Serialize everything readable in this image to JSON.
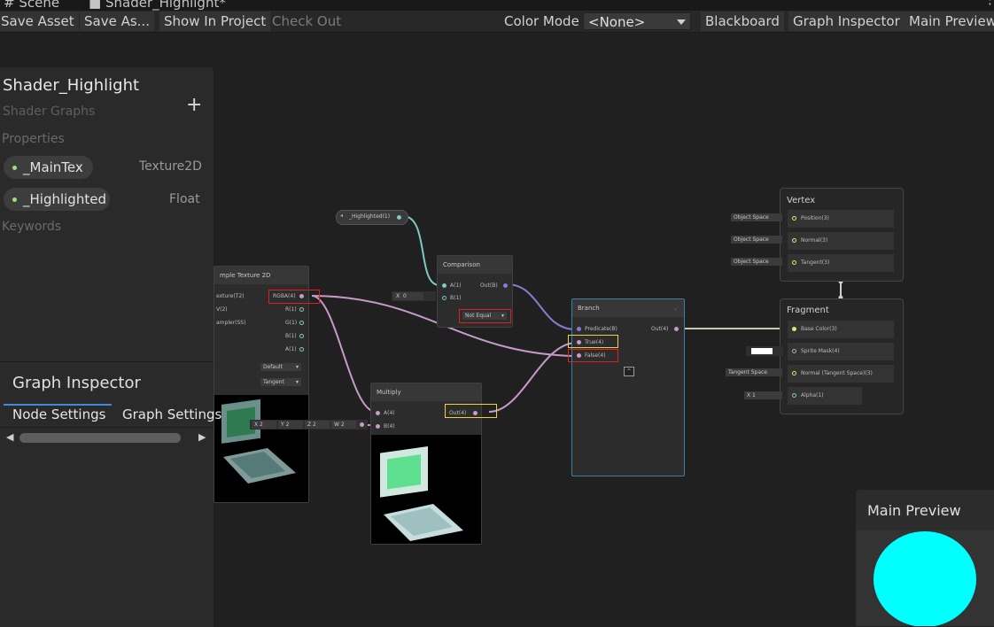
{
  "tabs": [
    {
      "label": "Scene",
      "icon": "hash-icon"
    },
    {
      "label": "Shader_Highlight*",
      "icon": "shader-icon"
    }
  ],
  "toolbar": {
    "save_asset": "Save Asset",
    "save_as": "Save As...",
    "show_in_project": "Show In Project",
    "check_out": "Check Out",
    "color_mode_label": "Color Mode",
    "color_mode_value": "<None>",
    "blackboard": "Blackboard",
    "graph_inspector": "Graph Inspector",
    "main_preview": "Main Preview"
  },
  "blackboard": {
    "title": "Shader_Highlight",
    "subtitle": "Shader Graphs",
    "add_icon": "plus-icon",
    "properties_header": "Properties",
    "properties": [
      {
        "name": "_MainTex",
        "type": "Texture2D"
      },
      {
        "name": "_Highlighted",
        "type": "Float"
      }
    ],
    "keywords_header": "Keywords"
  },
  "inspector": {
    "title": "Graph Inspector",
    "tabs": [
      "Node Settings",
      "Graph Settings"
    ]
  },
  "main_preview": {
    "title": "Main Preview",
    "preview_color": "#00ffff"
  },
  "graph": {
    "property_node": {
      "label": "_Highlighted(1)"
    },
    "sample_texture": {
      "title": "mple Texture 2D",
      "inputs": [
        "exture(T2)",
        "V(2)",
        "ampler(SS)"
      ],
      "outputs": [
        "RGBA(4)",
        "R(1)",
        "G(1)",
        "B(1)",
        "A(1)"
      ],
      "type_value": "Default",
      "space_value": "Tangent"
    },
    "vector_input": {
      "x_label": "X",
      "x": "2",
      "y_label": "Y",
      "y": "2",
      "z_label": "Z",
      "z": "2",
      "w_label": "W",
      "w": "2"
    },
    "comparison": {
      "title": "Comparison",
      "inputs": [
        "A(1)",
        "B(1)"
      ],
      "output": "Out(B)",
      "b_label": "X",
      "b_value": "0",
      "mode": "Not Equal"
    },
    "multiply": {
      "title": "Multiply",
      "inputs": [
        "A(4)",
        "B(4)"
      ],
      "output": "Out(4)"
    },
    "branch": {
      "title": "Branch",
      "inputs": [
        "Predicate(B)",
        "True(4)",
        "False(4)"
      ],
      "output": "Out(4)"
    },
    "vertex": {
      "title": "Vertex",
      "ports": [
        {
          "space": "Object Space",
          "label": "Position(3)"
        },
        {
          "space": "Object Space",
          "label": "Normal(3)"
        },
        {
          "space": "Object Space",
          "label": "Tangent(3)"
        }
      ]
    },
    "fragment": {
      "title": "Fragment",
      "ports": [
        {
          "space": "",
          "label": "Base Color(3)"
        },
        {
          "space": "",
          "label": "Sprite Mask(4)"
        },
        {
          "space": "Tangent Space",
          "label": "Normal (Tangent Space)(3)"
        },
        {
          "space": "X 1",
          "label": "Alpha(1)"
        }
      ]
    }
  },
  "colors": {
    "float_wire": "#7ec9c0",
    "bool_wire": "#8a7ad0",
    "vector4_wire": "#c69ac8",
    "highlight_red": "#e02020",
    "highlight_yellow": "#f0d040",
    "selected_node": "#3c7fa8"
  }
}
